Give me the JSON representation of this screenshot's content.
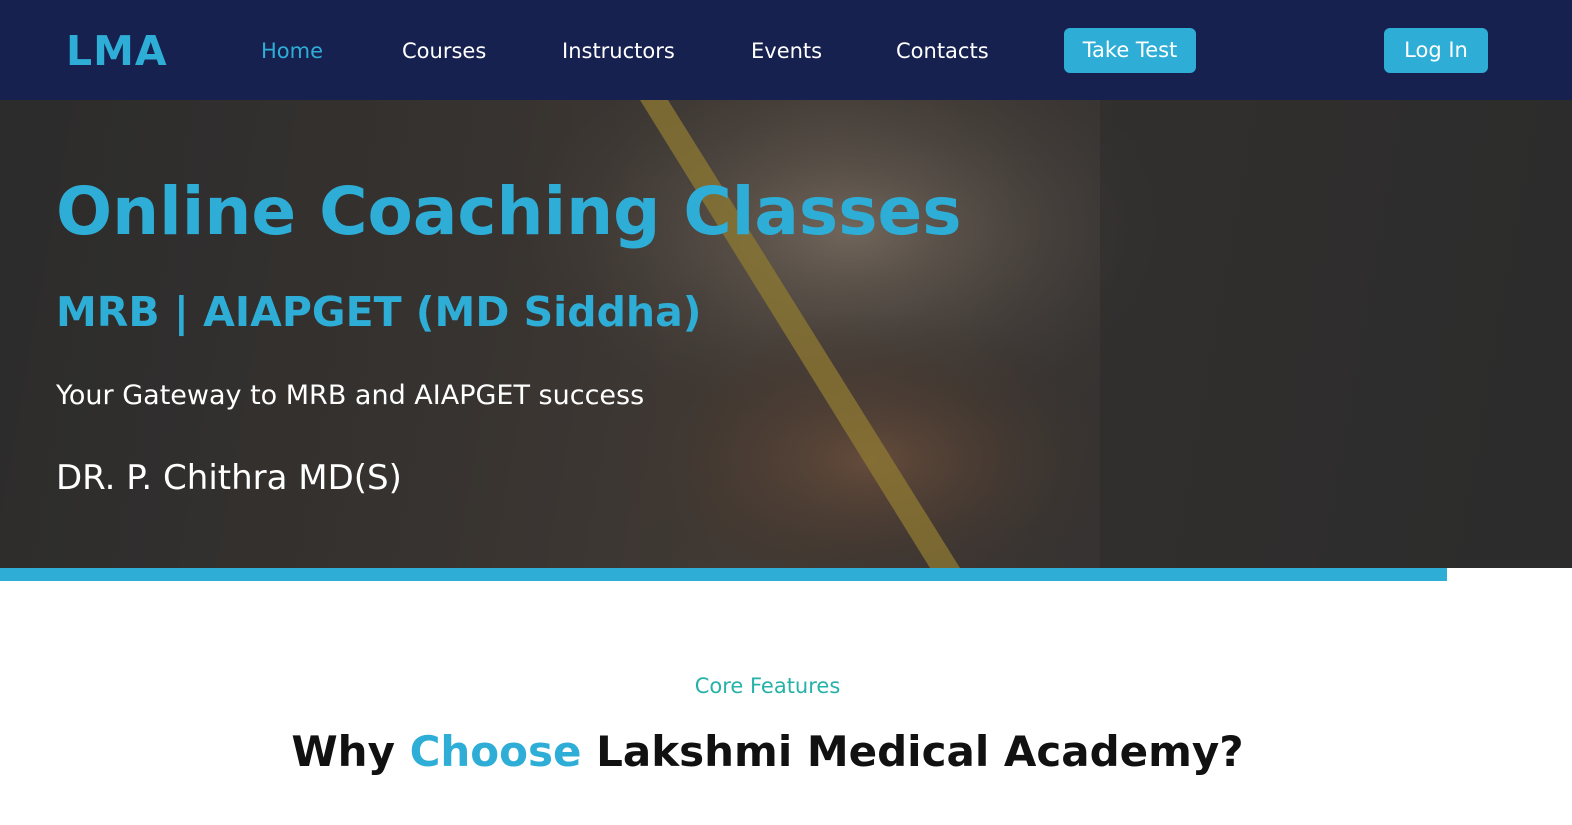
{
  "brand": {
    "logo": "LMA",
    "accent_color": "#2eaed6",
    "nav_bg_color": "#172150"
  },
  "nav": {
    "items": [
      {
        "label": "Home",
        "active": true
      },
      {
        "label": "Courses",
        "active": false
      },
      {
        "label": "Instructors",
        "active": false
      },
      {
        "label": "Events",
        "active": false
      },
      {
        "label": "Contacts",
        "active": false
      }
    ],
    "take_test_label": "Take Test",
    "login_label": "Log In"
  },
  "hero": {
    "title": "Online Coaching Classes",
    "subtitle": "MRB | AIAPGET (MD Siddha)",
    "tagline": "Your Gateway to MRB and AIAPGET success",
    "author": "DR. P. Chithra MD(S)"
  },
  "features": {
    "kicker": "Core Features",
    "heading_prefix": "Why ",
    "heading_highlight": "Choose",
    "heading_suffix": " Lakshmi Medical Academy?"
  }
}
